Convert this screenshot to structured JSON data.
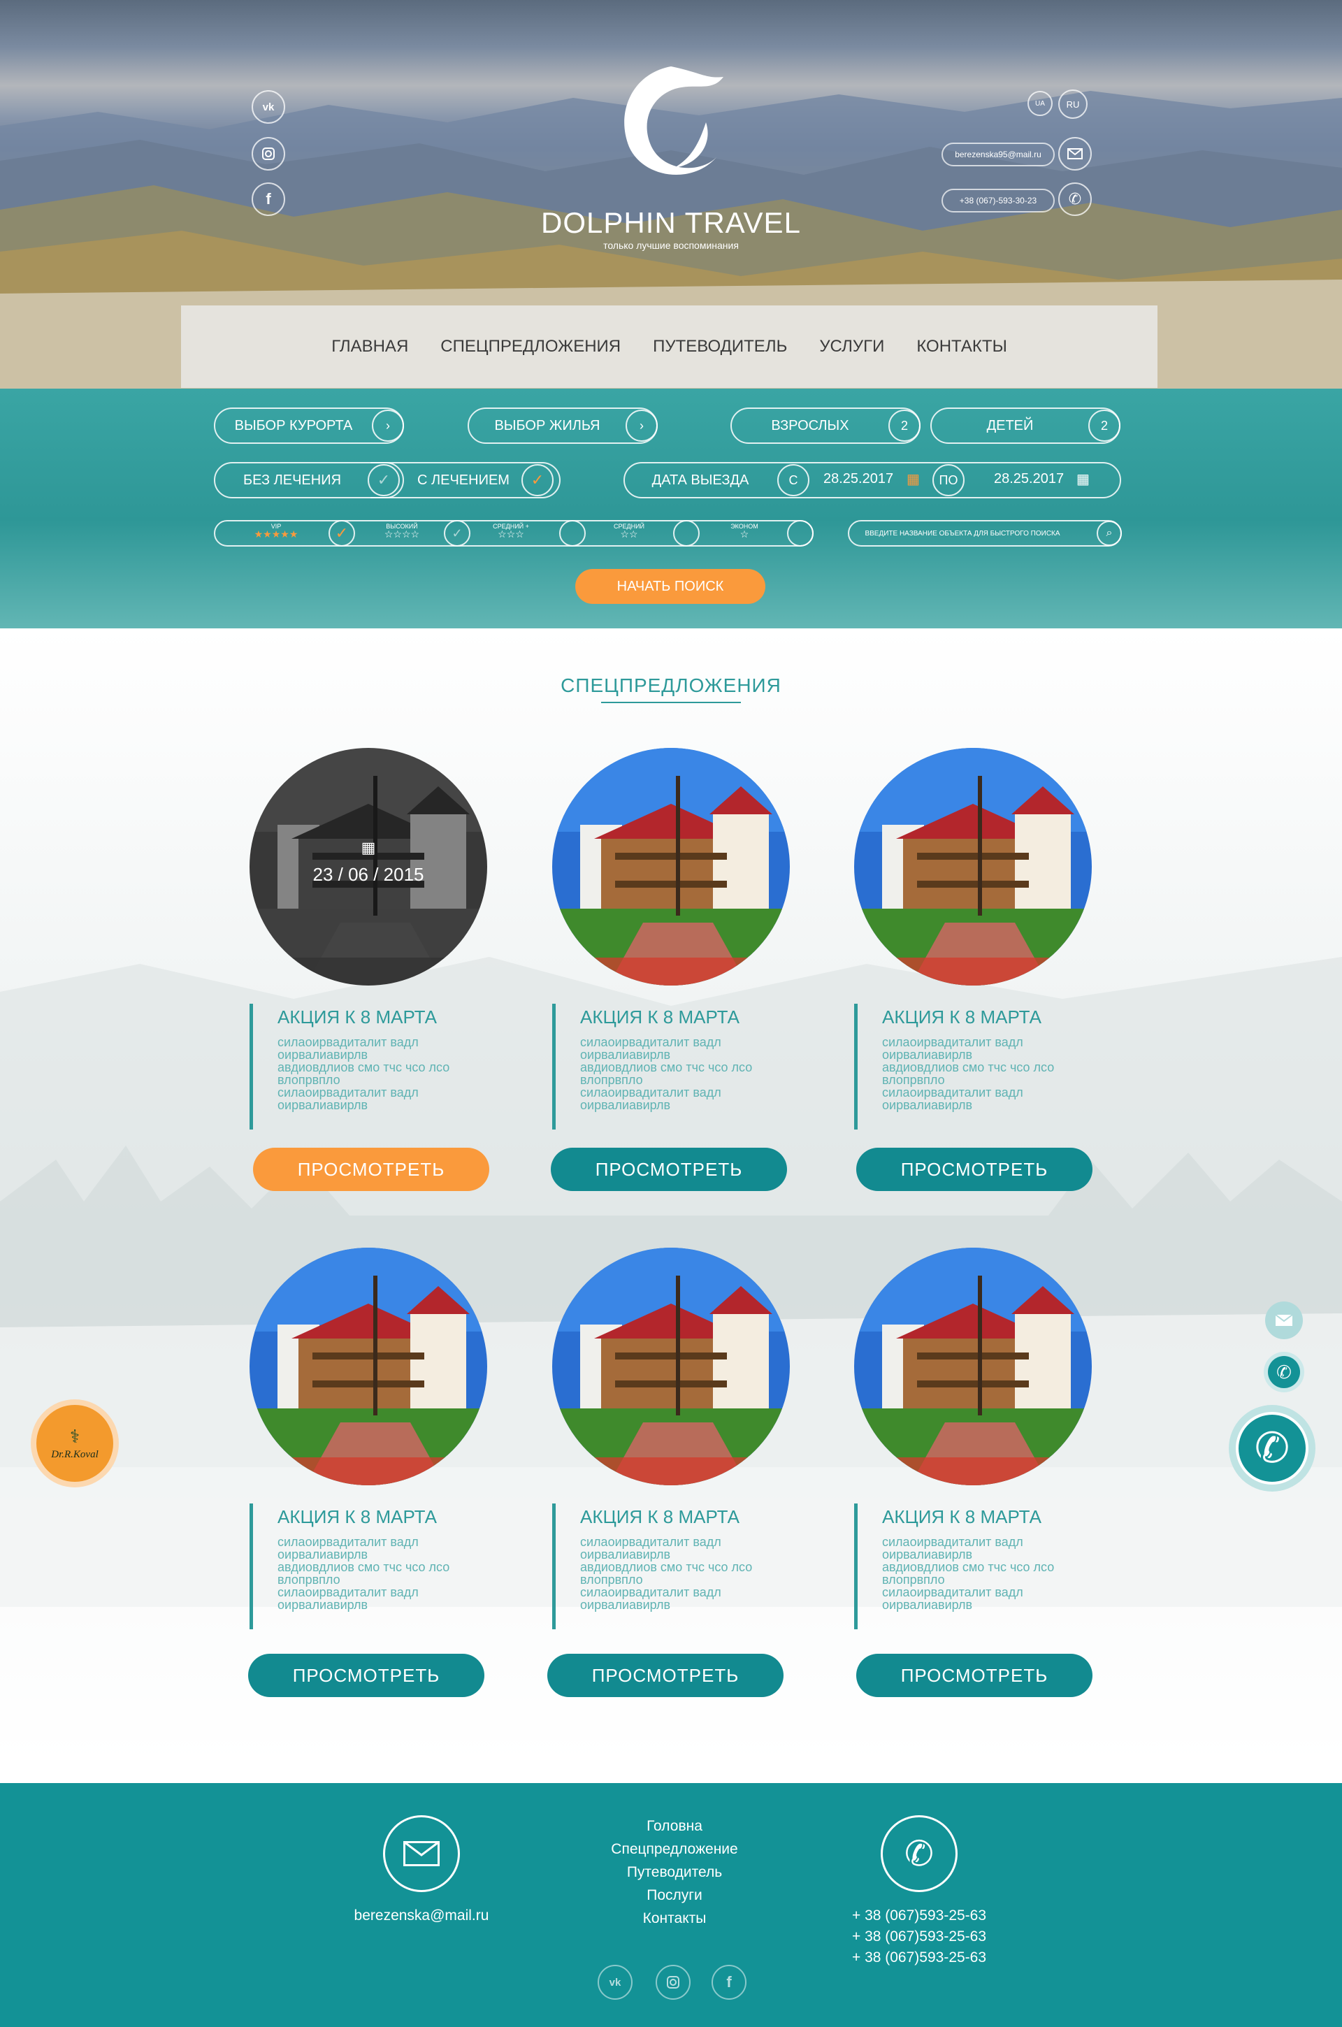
{
  "brand": {
    "name": "DOLPHIN TRAVEL",
    "tagline": "только лучшие воспоминания"
  },
  "header": {
    "social": [
      "vk-icon",
      "instagram-icon",
      "facebook-icon"
    ],
    "languages": [
      "UA",
      "RU"
    ],
    "email": "berezenska95@mail.ru",
    "phone": "+38 (067)-593-30-23"
  },
  "nav": {
    "items": [
      "ГЛАВНАЯ",
      "СПЕЦПРЕДЛОЖЕНИЯ",
      "ПУТЕВОДИТЕЛЬ",
      "УСЛУГИ",
      "КОНТАКТЫ"
    ]
  },
  "search": {
    "resort": "ВЫБОР КУРОРТА",
    "housing": "ВЫБОР ЖИЛЬЯ",
    "adults_label": "ВЗРОСЛЫХ",
    "adults_value": "2",
    "children_label": "ДЕТЕЙ",
    "children_value": "2",
    "no_treatment": "БЕЗ ЛЕЧЕНИЯ",
    "with_treatment": "С ЛЕЧЕНИЕМ",
    "treatment_selected": "with_treatment",
    "departure_label": "ДАТА ВЫЕЗДА",
    "from_label": "С",
    "from_date": "28.25.2017",
    "to_label": "ПО",
    "to_date": "28.25.2017",
    "categories": [
      {
        "label": "VIP",
        "stars": "★★★★★",
        "checked": true
      },
      {
        "label": "ВЫСОКИЙ",
        "stars": "☆☆☆☆",
        "checked": false
      },
      {
        "label": "СРЕДНИЙ +",
        "stars": "☆☆☆",
        "checked": false
      },
      {
        "label": "СРЕДНИЙ",
        "stars": "☆☆",
        "checked": false
      },
      {
        "label": "ЭКОНОМ",
        "stars": "☆",
        "checked": false
      }
    ],
    "quick_placeholder": "ВВЕДИТЕ НАЗВАНИЕ ОБЪЕКТА ДЛЯ БЫСТРОГО ПОИСКА",
    "submit": "НАЧАТЬ ПОИСК"
  },
  "offers": {
    "title": "СПЕЦПРЕДЛОЖЕНИЯ",
    "first_date": "23 / 06 / 2015",
    "cards": [
      {
        "title": "АКЦИЯ К 8 МАРТА",
        "lines": [
          "силаоирвадиталит вадл",
          "оирвалиавирлв",
          "авдиовдлиов смо тчс чсо лсо",
          "влопрвпло",
          "силаоирвадиталит вадл",
          "оирвалиавирлв"
        ],
        "button": "ПРОСМОТРЕТЬ"
      },
      {
        "title": "АКЦИЯ К 8 МАРТА",
        "lines": [
          "силаоирвадиталит вадл",
          "оирвалиавирлв",
          "авдиовдлиов смо тчс чсо лсо",
          "влопрвпло",
          "силаоирвадиталит вадл",
          "оирвалиавирлв"
        ],
        "button": "ПРОСМОТРЕТЬ"
      },
      {
        "title": "АКЦИЯ К 8 МАРТА",
        "lines": [
          "силаоирвадиталит вадл",
          "оирвалиавирлв",
          "авдиовдлиов смо тчс чсо лсо",
          "влопрвпло",
          "силаоирвадиталит вадл",
          "оирвалиавирлв"
        ],
        "button": "ПРОСМОТРЕТЬ"
      },
      {
        "title": "АКЦИЯ К 8 МАРТА",
        "lines": [
          "силаоирвадиталит вадл",
          "оирвалиавирлв",
          "авдиовдлиов смо тчс чсо лсо",
          "влопрвпло",
          "силаоирвадиталит вадл",
          "оирвалиавирлв"
        ],
        "button": "ПРОСМОТРЕТЬ"
      },
      {
        "title": "АКЦИЯ К 8 МАРТА",
        "lines": [
          "силаоирвадиталит вадл",
          "оирвалиавирлв",
          "авдиовдлиов смо тчс чсо лсо",
          "влопрвпло",
          "силаоирвадиталит вадл",
          "оирвалиавирлв"
        ],
        "button": "ПРОСМОТРЕТЬ"
      },
      {
        "title": "АКЦИЯ К 8 МАРТА",
        "lines": [
          "силаоирвадиталит вадл",
          "оирвалиавирлв",
          "авдиовдлиов смо тчс чсо лсо",
          "влопрвпло",
          "силаоирвадиталит вадл",
          "оирвалиавирлв"
        ],
        "button": "ПРОСМОТРЕТЬ"
      }
    ]
  },
  "badge": {
    "text": "Dr.R.Koval"
  },
  "footer": {
    "email": "berezenska@mail.ru",
    "links": [
      "Головна",
      "Спецпредложение",
      "Путеводитель",
      "Послуги",
      "Контакты"
    ],
    "phones": [
      "+ 38 (067)593-25-63",
      "+ 38 (067)593-25-63",
      "+ 38 (067)593-25-63"
    ]
  },
  "colors": {
    "teal": "#139296",
    "orange": "#fa9a3c",
    "nav_text": "#3b3b3b"
  }
}
